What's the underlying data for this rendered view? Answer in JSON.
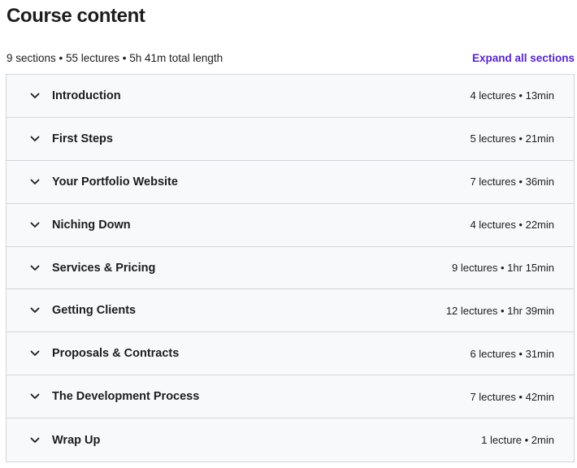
{
  "header": {
    "title": "Course content"
  },
  "summary": {
    "text": "9 sections • 55 lectures • 5h 41m total length",
    "expand_label": "Expand all sections"
  },
  "colors": {
    "link": "#5624d0",
    "row_bg": "#f7f9fa",
    "border": "#d1d7dc",
    "text": "#1c1d1f"
  },
  "sections": [
    {
      "title": "Introduction",
      "meta": "4 lectures • 13min",
      "icon": "chevron-down-icon"
    },
    {
      "title": "First Steps",
      "meta": "5 lectures • 21min",
      "icon": "chevron-down-icon"
    },
    {
      "title": "Your Portfolio Website",
      "meta": "7 lectures • 36min",
      "icon": "chevron-down-icon"
    },
    {
      "title": "Niching Down",
      "meta": "4 lectures • 22min",
      "icon": "chevron-down-icon"
    },
    {
      "title": "Services & Pricing",
      "meta": "9 lectures • 1hr 15min",
      "icon": "chevron-down-icon"
    },
    {
      "title": "Getting Clients",
      "meta": "12 lectures • 1hr 39min",
      "icon": "chevron-down-icon"
    },
    {
      "title": "Proposals & Contracts",
      "meta": "6 lectures • 31min",
      "icon": "chevron-down-icon"
    },
    {
      "title": "The Development Process",
      "meta": "7 lectures • 42min",
      "icon": "chevron-down-icon"
    },
    {
      "title": "Wrap Up",
      "meta": "1 lecture • 2min",
      "icon": "chevron-down-icon"
    }
  ]
}
